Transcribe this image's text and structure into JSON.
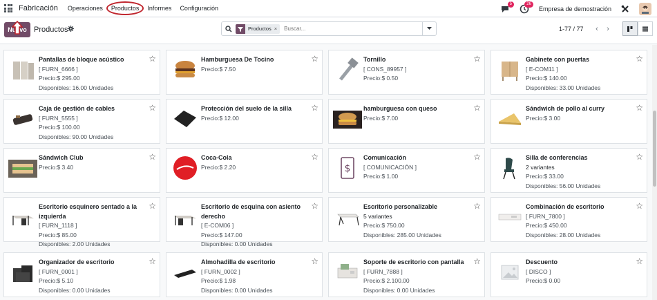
{
  "navbar": {
    "app_name": "Fabricación",
    "menu": [
      {
        "label": "Operaciones",
        "circled": false
      },
      {
        "label": "Productos",
        "circled": true
      },
      {
        "label": "Informes",
        "circled": false
      },
      {
        "label": "Configuración",
        "circled": false
      }
    ],
    "messages_count": "5",
    "activities_count": "26",
    "company": "Empresa de demostración"
  },
  "control": {
    "new_label": "Nuevo",
    "title": "Productos",
    "facet_label": "Productos",
    "facet_remove": "×",
    "search_placeholder": "Buscar...",
    "pager": "1-77 / 77"
  },
  "colors": {
    "brand": "#714b67",
    "annotation": "#c0262e",
    "badge": "#e0245e"
  },
  "products": [
    {
      "name": "Pantallas de bloque acústico",
      "ref": "[ FURN_6666 ]",
      "price": "Precio:$ 295.00",
      "stock": "Disponibles: 16.00 Unidades",
      "icon": "screen-icon"
    },
    {
      "name": "Hamburguesa De Tocino",
      "ref": "",
      "price": "Precio:$ 7.50",
      "stock": "",
      "icon": "burger-icon"
    },
    {
      "name": "Tornillo",
      "ref": "[ CONS_89957 ]",
      "price": "Precio:$ 0.50",
      "stock": "",
      "icon": "screw-icon"
    },
    {
      "name": "Gabinete con puertas",
      "ref": "[ E-COM11 ]",
      "price": "Precio:$ 140.00",
      "stock": "Disponibles: 33.00 Unidades",
      "icon": "cabinet-icon"
    },
    {
      "name": "Caja de gestión de cables",
      "ref": "[ FURN_5555 ]",
      "price": "Precio:$ 100.00",
      "stock": "Disponibles: 90.00 Unidades",
      "icon": "cable-box-icon"
    },
    {
      "name": "Protección del suelo de la silla",
      "ref": "",
      "price": "Precio:$ 12.00",
      "stock": "",
      "icon": "floor-mat-icon"
    },
    {
      "name": "hamburguesa con queso",
      "ref": "",
      "price": "Precio:$ 7.00",
      "stock": "",
      "icon": "cheeseburger-icon"
    },
    {
      "name": "Sándwich de pollo al curry",
      "ref": "",
      "price": "Precio:$ 3.00",
      "stock": "",
      "icon": "sandwich-icon"
    },
    {
      "name": "Sándwich Club",
      "ref": "",
      "price": "Precio:$ 3.40",
      "stock": "",
      "icon": "club-sandwich-icon"
    },
    {
      "name": "Coca-Cola",
      "ref": "",
      "price": "Precio:$ 2.20",
      "stock": "",
      "icon": "coca-cola-icon"
    },
    {
      "name": "Comunicación",
      "ref": "[ COMUNICACIÓN ]",
      "price": "Precio:$ 1.00",
      "stock": "",
      "icon": "dollar-doc-icon"
    },
    {
      "name": "Silla de conferencias",
      "ref": "2 variantes",
      "price": "Precio:$ 33.00",
      "stock": "Disponibles: 56.00 Unidades",
      "icon": "chair-icon"
    },
    {
      "name": "Escritorio esquinero sentado a la izquierda",
      "ref": "[ FURN_1118 ]",
      "price": "Precio:$ 85.00",
      "stock": "Disponibles: 2.00 Unidades",
      "icon": "corner-desk-icon"
    },
    {
      "name": "Escritorio de esquina con asiento derecho",
      "ref": "[ E-COM06 ]",
      "price": "Precio:$ 147.00",
      "stock": "Disponibles: 0.00 Unidades",
      "icon": "corner-desk-right-icon"
    },
    {
      "name": "Escritorio personalizable",
      "ref": "5 variantes",
      "price": "Precio:$ 750.00",
      "stock": "Disponibles: 285.00 Unidades",
      "icon": "desk-icon"
    },
    {
      "name": "Combinación de escritorio",
      "ref": "[ FURN_7800 ]",
      "price": "Precio:$ 450.00",
      "stock": "Disponibles: 28.00 Unidades",
      "icon": "desk-combo-icon"
    },
    {
      "name": "Organizador de escritorio",
      "ref": "[ FURN_0001 ]",
      "price": "Precio:$ 5.10",
      "stock": "Disponibles: 0.00 Unidades",
      "icon": "organizer-icon"
    },
    {
      "name": "Almohadilla de escritorio",
      "ref": "[ FURN_0002 ]",
      "price": "Precio:$ 1.98",
      "stock": "Disponibles: 0.00 Unidades",
      "icon": "desk-pad-icon"
    },
    {
      "name": "Soporte de escritorio con pantalla",
      "ref": "[ FURN_7888 ]",
      "price": "Precio:$ 2.100.00",
      "stock": "Disponibles: 0.00 Unidades",
      "icon": "monitor-stand-icon"
    },
    {
      "name": "Descuento",
      "ref": "[ DISCO ]",
      "price": "Precio:$ 0.00",
      "stock": "",
      "icon": "placeholder-image-icon"
    }
  ]
}
